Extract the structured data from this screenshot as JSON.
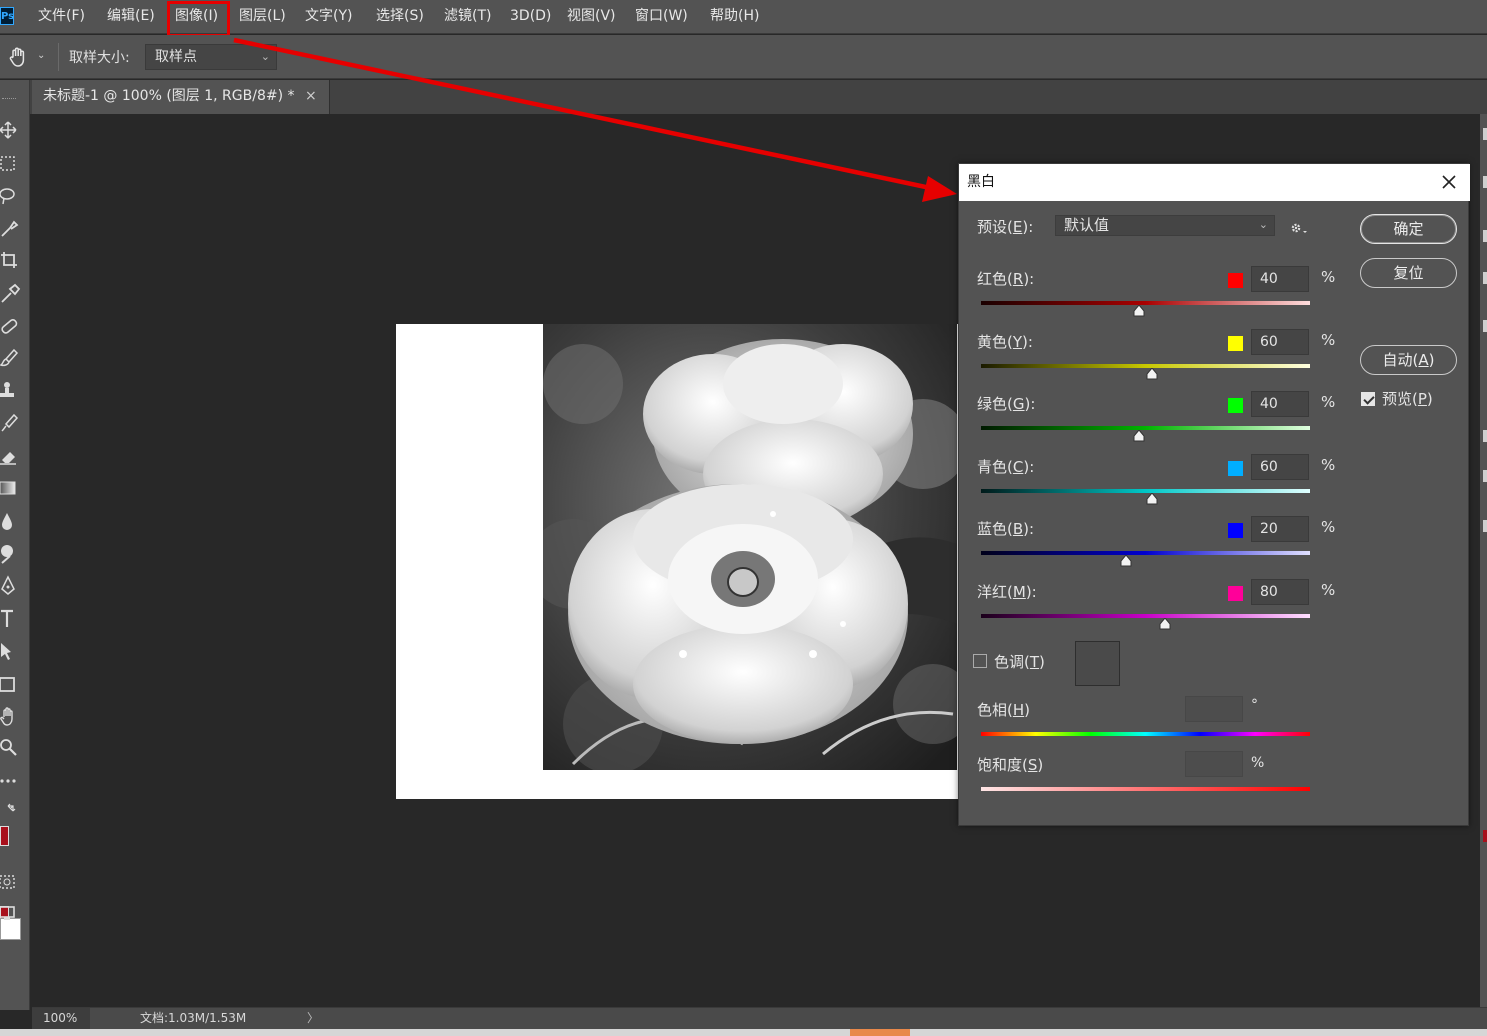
{
  "app": {
    "logo": "Ps",
    "menu": [
      {
        "label": "文件(F)"
      },
      {
        "label": "编辑(E)"
      },
      {
        "label": "图像(I)",
        "highlighted": true
      },
      {
        "label": "图层(L)"
      },
      {
        "label": "文字(Y)"
      },
      {
        "label": "选择(S)"
      },
      {
        "label": "滤镜(T)"
      },
      {
        "label": "3D(D)"
      },
      {
        "label": "视图(V)"
      },
      {
        "label": "窗口(W)"
      },
      {
        "label": "帮助(H)"
      }
    ],
    "annotation_color": "#e60000"
  },
  "options_bar": {
    "tool_icon": "hand-icon",
    "sample_size_label": "取样大小:",
    "sample_size_value": "取样点"
  },
  "document_tab": {
    "title": "未标题-1 @ 100% (图层 1, RGB/8#) *",
    "close": "×"
  },
  "status_bar": {
    "zoom": "100%",
    "doc_info": "文档:1.03M/1.53M",
    "arrow": "〉"
  },
  "dialog": {
    "title": "黑白",
    "preset_label": "预设",
    "preset_key": "E",
    "preset_value": "默认值",
    "ok_label": "确定",
    "reset_label": "复位",
    "auto_label": "自动",
    "auto_key": "A",
    "preview_label": "预览",
    "preview_key": "P",
    "preview_checked": true,
    "sliders": [
      {
        "name": "红色",
        "key": "R",
        "value": "40",
        "unit": "%",
        "swatch": "#ff0000",
        "gradient": [
          "#1a0000",
          "#aa0000",
          "#ffdede"
        ],
        "position": 0.48
      },
      {
        "name": "黄色",
        "key": "Y",
        "value": "60",
        "unit": "%",
        "swatch": "#ffff00",
        "gradient": [
          "#1a1a00",
          "#c8c800",
          "#ffffe0"
        ],
        "position": 0.52
      },
      {
        "name": "绿色",
        "key": "G",
        "value": "40",
        "unit": "%",
        "swatch": "#00ff00",
        "gradient": [
          "#001a00",
          "#00b400",
          "#e0ffe0"
        ],
        "position": 0.48
      },
      {
        "name": "青色",
        "key": "C",
        "value": "60",
        "unit": "%",
        "swatch": "#00aeff",
        "gradient": [
          "#001a1a",
          "#00c8c8",
          "#e0ffff"
        ],
        "position": 0.52
      },
      {
        "name": "蓝色",
        "key": "B",
        "value": "20",
        "unit": "%",
        "swatch": "#0000ff",
        "gradient": [
          "#00001a",
          "#0000d0",
          "#e0e0ff"
        ],
        "position": 0.44
      },
      {
        "name": "洋红",
        "key": "M",
        "value": "80",
        "unit": "%",
        "swatch": "#ff0099",
        "gradient": [
          "#1a001a",
          "#c800c8",
          "#ffe0ff"
        ],
        "position": 0.56
      }
    ],
    "tint_label": "色调",
    "tint_key": "T",
    "tint_checked": false,
    "hue_label": "色相",
    "hue_key": "H",
    "hue_unit": "°",
    "saturation_label": "饱和度",
    "saturation_key": "S",
    "saturation_unit": "%"
  }
}
